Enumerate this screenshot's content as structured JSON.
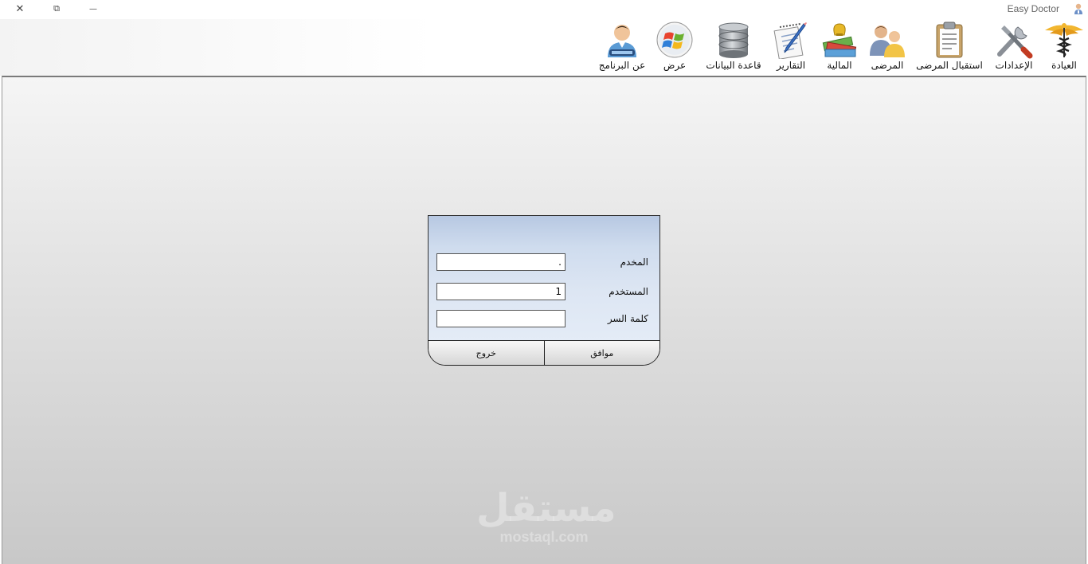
{
  "window": {
    "title": "Easy Doctor",
    "close_glyph": "✕",
    "max_glyph": "⧉",
    "min_glyph": "—"
  },
  "toolbar": {
    "items": [
      {
        "label": "العيادة",
        "icon": "caduceus-icon"
      },
      {
        "label": "الإعدادات",
        "icon": "tools-icon"
      },
      {
        "label": "استقبال المرضى",
        "icon": "clipboard-icon"
      },
      {
        "label": "المرضى",
        "icon": "patients-icon"
      },
      {
        "label": "المالية",
        "icon": "money-icon"
      },
      {
        "label": "التقارير",
        "icon": "report-pencil-icon"
      },
      {
        "label": "قاعدة البيانات",
        "icon": "database-icon"
      },
      {
        "label": "عرض",
        "icon": "windows-logo-icon"
      },
      {
        "label": "عن البرنامج",
        "icon": "user-about-icon"
      }
    ]
  },
  "login": {
    "server_label": "المخدم",
    "server_value": ".",
    "user_label": "المستخدم",
    "user_value": "1",
    "password_label": "كلمة السر",
    "password_value": "",
    "ok_label": "موافق",
    "exit_label": "خروج"
  },
  "watermark": {
    "arabic": "مستقل",
    "latin": "mostaql.com"
  },
  "colors": {
    "dialog_header": "#b7c8e2",
    "workspace_bottom": "#c8c8c8"
  }
}
